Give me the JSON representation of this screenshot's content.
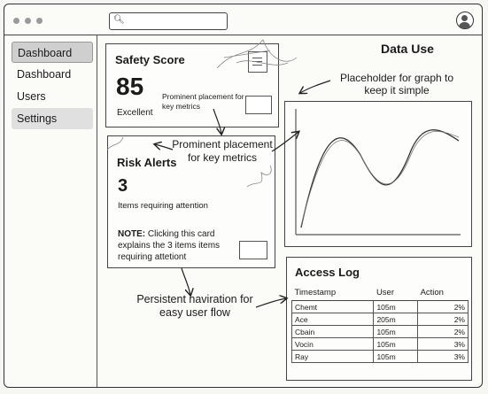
{
  "header": {
    "search": {
      "placeholder": "",
      "value": ""
    },
    "avatar_icon": "user-avatar-icon"
  },
  "sidebar": {
    "items": [
      {
        "label": "Dashboard",
        "state": "active"
      },
      {
        "label": "Dashboard",
        "state": "normal"
      },
      {
        "label": "Users",
        "state": "normal"
      },
      {
        "label": "Settings",
        "state": "shaded"
      }
    ]
  },
  "safety_card": {
    "title": "Safety Score",
    "score": "85",
    "rating": "Excellent",
    "annotation": "Prominent placement for key metrics"
  },
  "risk_card": {
    "title": "Risk Alerts",
    "count": "3",
    "subtitle": "Items requiring attention",
    "note_bold": "NOTE:",
    "note_text": " Clicking this card explains the 3 items items requiring attetiont"
  },
  "annotations": {
    "metrics": "Prominent placement for key metrics",
    "graph": "Placeholder for graph to keep it simple",
    "nav": "Persistent naviration for easy user flow"
  },
  "data_use": {
    "title": "Data Use"
  },
  "access_log": {
    "title": "Access Log",
    "columns": [
      "Timestamp",
      "User",
      "Action"
    ],
    "rows": [
      [
        "Chemt",
        "105m",
        "2%"
      ],
      [
        "Ace",
        "205m",
        "2%"
      ],
      [
        "Cbain",
        "105m",
        "2%"
      ],
      [
        "Vocin",
        "105m",
        "3%"
      ],
      [
        "Ray",
        "105m",
        "3%"
      ]
    ]
  }
}
